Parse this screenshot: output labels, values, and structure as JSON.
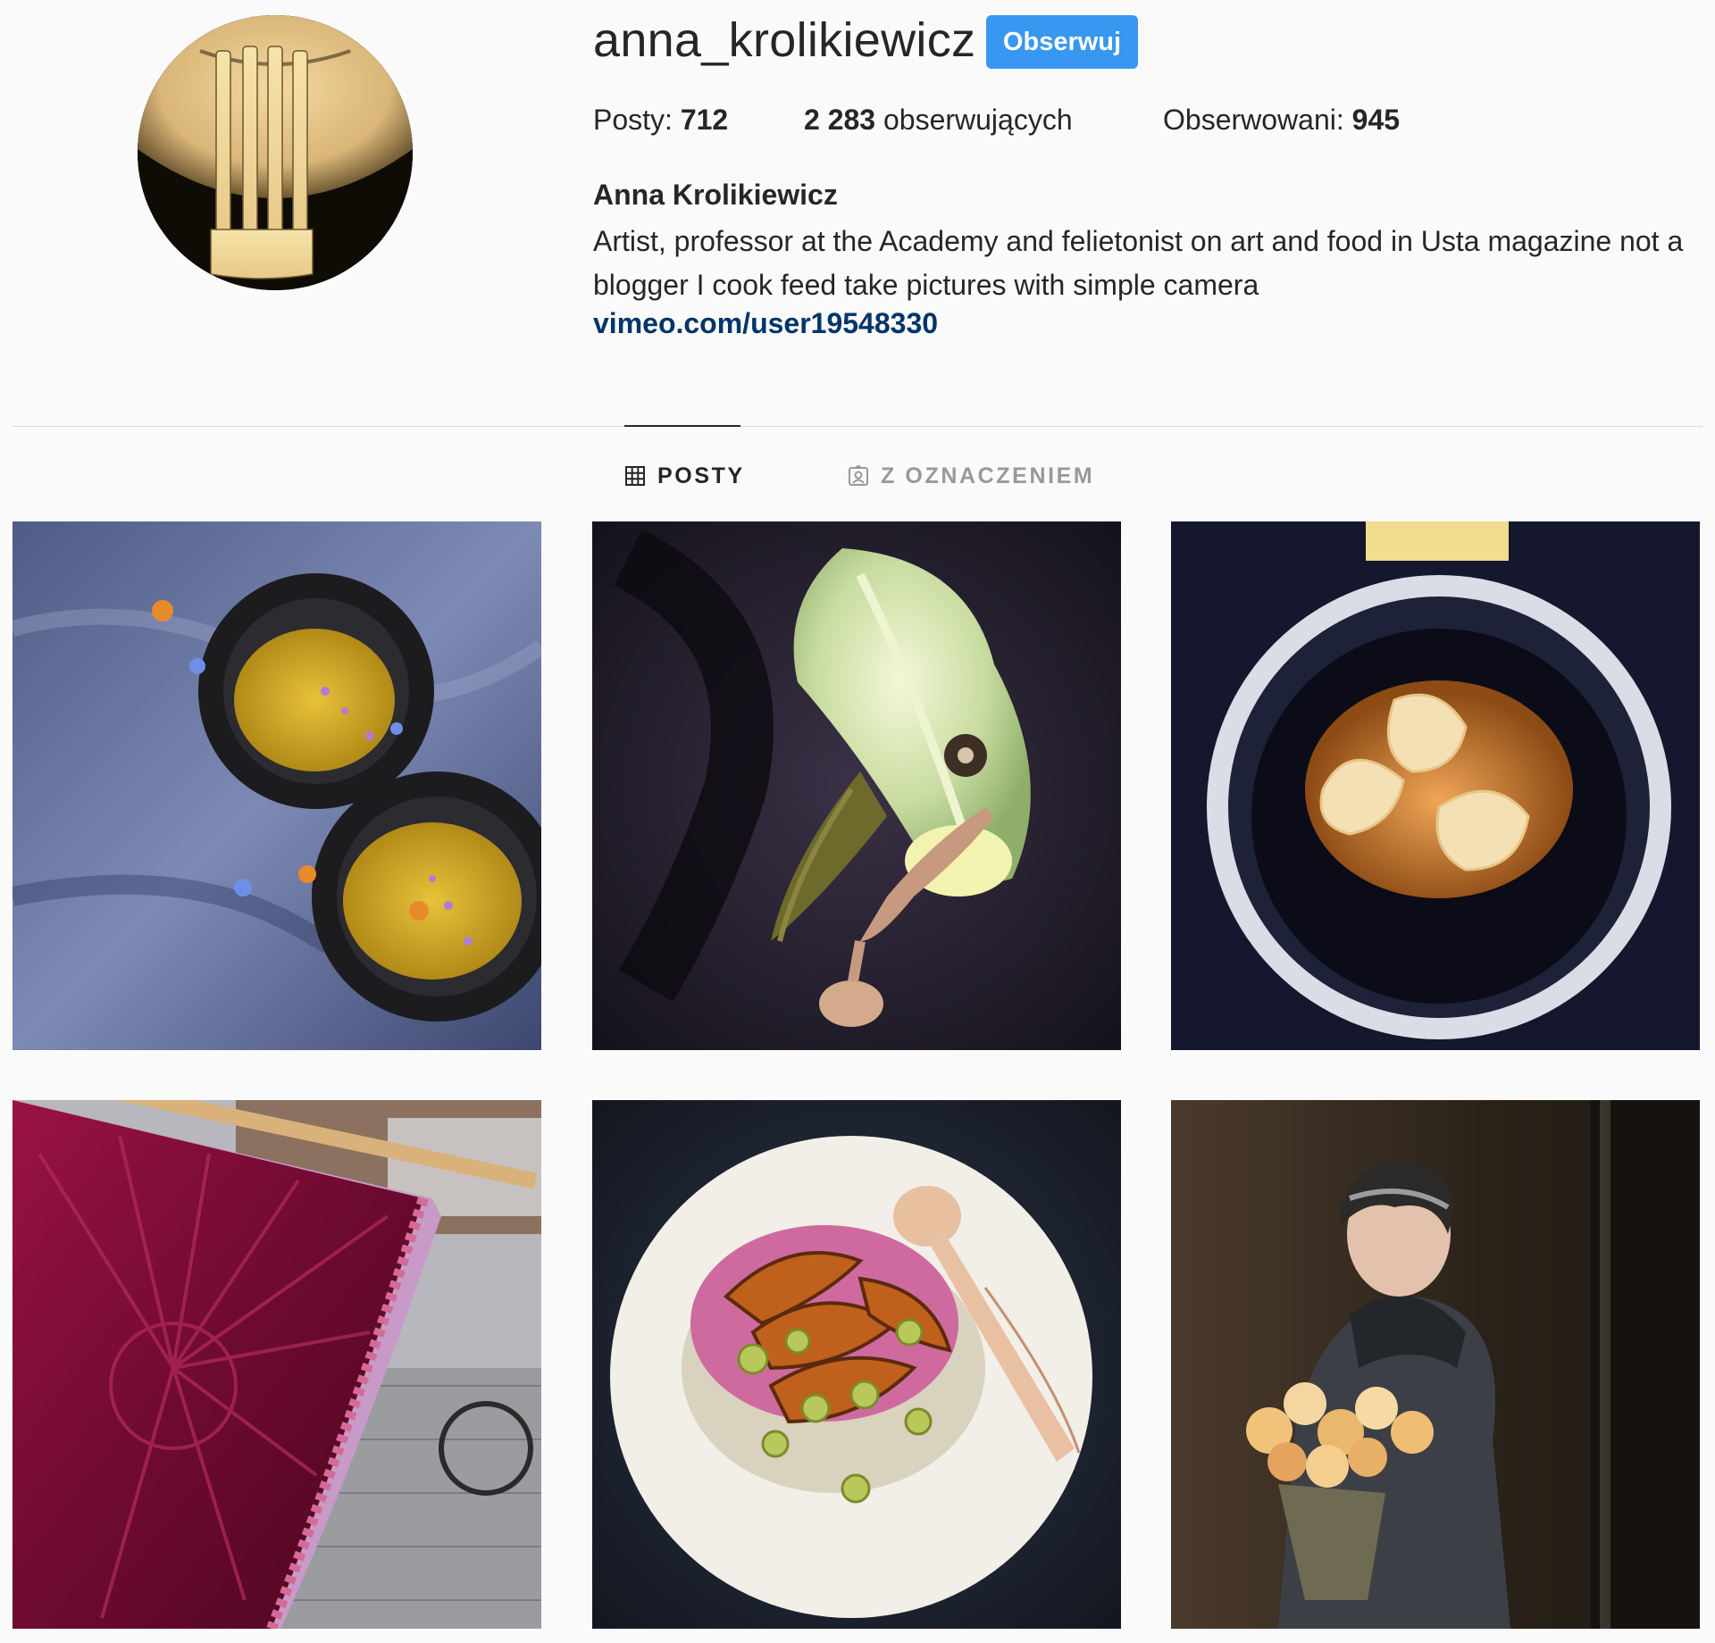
{
  "profile": {
    "username": "anna_krolikiewicz",
    "follow_label": "Obserwuj",
    "avatar_icon": "fork-photo",
    "stats": {
      "posts_label": "Posty: ",
      "posts_count": "712",
      "followers_count": "2 283",
      "followers_label": " obserwujących",
      "following_label": "Obserwowani: ",
      "following_count": "945"
    },
    "full_name": "Anna Krolikiewicz",
    "bio": "Artist, professor at the Academy and felietonist on art and food in Usta magazine not a blogger I cook feed take pictures with simple camera",
    "link": "vimeo.com/user19548330"
  },
  "tabs": [
    {
      "label": "POSTY",
      "icon": "grid-icon",
      "active": true
    },
    {
      "label": "Z OZNACZENIEM",
      "icon": "tagged-user-icon",
      "active": false
    }
  ],
  "colors": {
    "follow_button": "#3897f0",
    "link": "#003569",
    "background": "#fafafa",
    "inactive_tab": "#999999"
  },
  "posts": [
    {
      "subject": "yellow-soup-bowls-photo"
    },
    {
      "subject": "cabbage-leaf-feather-spoon-photo"
    },
    {
      "subject": "dumplings-broth-bowl-photo"
    },
    {
      "subject": "burgundy-quilted-banner-photo"
    },
    {
      "subject": "roasted-pumpkin-plate-photo"
    },
    {
      "subject": "woman-with-roses-photo"
    }
  ]
}
